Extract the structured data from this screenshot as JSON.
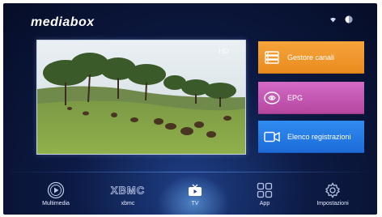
{
  "header": {
    "brand": "mediabox",
    "icons": [
      "wifi-icon",
      "settings-dot-icon"
    ]
  },
  "tiles": [
    {
      "label": "Gestore canali",
      "icon": "channel-list-icon",
      "color": "#f09a2c"
    },
    {
      "label": "EPG",
      "icon": "epg-icon",
      "color": "#c457b3"
    },
    {
      "label": "Elenco registrazioni",
      "icon": "video-camera-icon",
      "color": "#2679e6"
    }
  ],
  "bottom": [
    {
      "label": "Multimedia",
      "icon": "play-circle-icon"
    },
    {
      "label": "xbmc",
      "icon": "xbmc-logo"
    },
    {
      "label": "TV",
      "icon": "tv-icon",
      "selected": true
    },
    {
      "label": "App",
      "icon": "apps-grid-icon"
    },
    {
      "label": "Impostazioni",
      "icon": "gear-icon"
    }
  ],
  "preview": {
    "watermark": "HD"
  },
  "colors": {
    "background": "#0c1a44",
    "accent_glow": "#78beff"
  }
}
